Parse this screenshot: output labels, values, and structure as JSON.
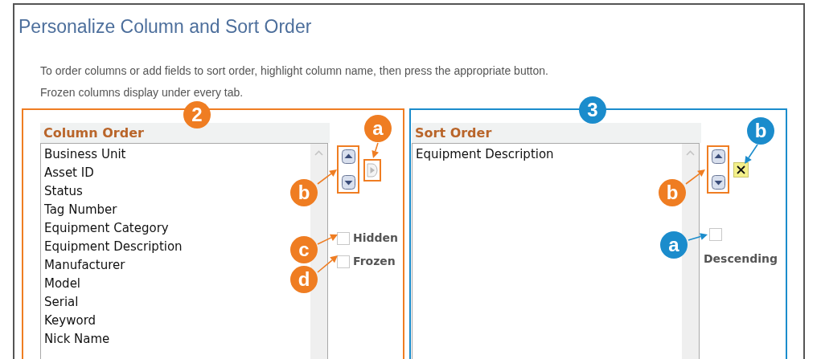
{
  "window": {
    "title": "Personalize Column and Sort Order"
  },
  "instructions": [
    "To order columns or add fields to sort order, highlight column name, then press the appropriate button.",
    "Frozen columns display under every tab."
  ],
  "column_order": {
    "heading": "Column Order",
    "items": [
      {
        "label": "Business Unit",
        "selected": false
      },
      {
        "label": "Asset ID",
        "selected": false
      },
      {
        "label": "Status",
        "selected": false
      },
      {
        "label": "Tag Number",
        "selected": false
      },
      {
        "label": "Equipment Category",
        "selected": false
      },
      {
        "label": "Equipment Description",
        "selected": false
      },
      {
        "label": "Manufacturer",
        "selected": false
      },
      {
        "label": "Model",
        "selected": false
      },
      {
        "label": "Serial",
        "selected": false
      },
      {
        "label": "Keyword",
        "selected": false
      },
      {
        "label": "Nick Name",
        "selected": false
      }
    ],
    "hidden": {
      "label": "Hidden",
      "checked": false
    },
    "frozen": {
      "label": "Frozen",
      "checked": false
    },
    "callouts": [
      {
        "label": "2",
        "color": "#ef7d22"
      },
      {
        "label": "a",
        "color": "#ef7d22"
      },
      {
        "label": "b",
        "color": "#ef7d22"
      },
      {
        "label": "c",
        "color": "#ef7d22"
      },
      {
        "label": "d",
        "color": "#ef7d22"
      }
    ]
  },
  "sort_order": {
    "heading": "Sort Order",
    "items": [
      {
        "label": "Equipment Description",
        "selected": false
      }
    ],
    "descending": {
      "label": "Descending",
      "checked": false
    },
    "callouts": [
      {
        "label": "3",
        "color": "#1b8ccc"
      },
      {
        "label": "b",
        "color": "#1b8ccc"
      },
      {
        "label": "b",
        "color": "#ef7d22"
      },
      {
        "label": "a",
        "color": "#1b8ccc"
      }
    ]
  }
}
